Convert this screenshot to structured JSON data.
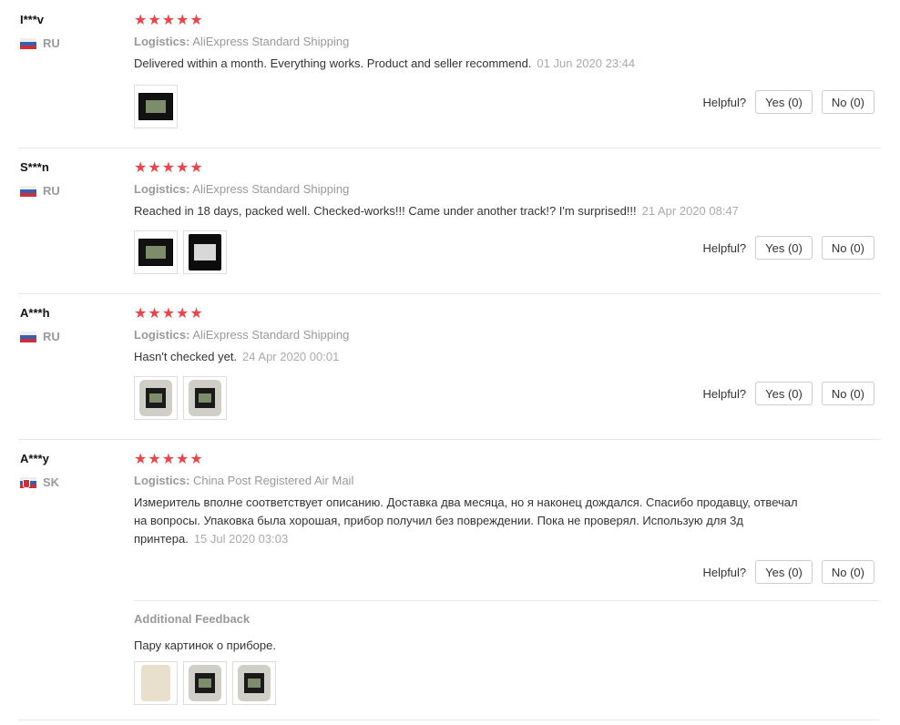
{
  "helpful_label": "Helpful?",
  "reviews": [
    {
      "user": "I***v",
      "country": "RU",
      "stars": "★★★★★",
      "logistics_label": "Logistics:",
      "logistics": "AliExpress Standard Shipping",
      "text": "Delivered within a month. Everything works. Product and seller recommend.",
      "date": "01 Jun 2020 23:44",
      "yes": "Yes (0)",
      "no": "No (0)"
    },
    {
      "user": "S***n",
      "country": "RU",
      "stars": "★★★★★",
      "logistics_label": "Logistics:",
      "logistics": "AliExpress Standard Shipping",
      "text": "Reached in 18 days, packed well. Checked-works!!! Came under another track!? I'm surprised!!!",
      "date": "21 Apr 2020 08:47",
      "yes": "Yes (0)",
      "no": "No (0)"
    },
    {
      "user": "A***h",
      "country": "RU",
      "stars": "★★★★★",
      "logistics_label": "Logistics:",
      "logistics": "AliExpress Standard Shipping",
      "text": "Hasn't checked yet.",
      "date": "24 Apr 2020 00:01",
      "yes": "Yes (0)",
      "no": "No (0)"
    },
    {
      "user": "A***y",
      "country": "SK",
      "stars": "★★★★★",
      "logistics_label": "Logistics:",
      "logistics": "China Post Registered Air Mail",
      "text": "Измеритель вполне соответствует описанию. Доставка два месяца, но я наконец дождался. Спасибо продавцу, отвечал на вопросы. Упаковка была хорошая, прибор получил без повреждении. Пока не проверял. Использую для 3д принтера.",
      "date": "15 Jul 2020 03:03",
      "yes": "Yes (0)",
      "no": "No (0)",
      "additional_title": "Additional Feedback",
      "additional_text": "Пару картинок о приборе."
    }
  ]
}
